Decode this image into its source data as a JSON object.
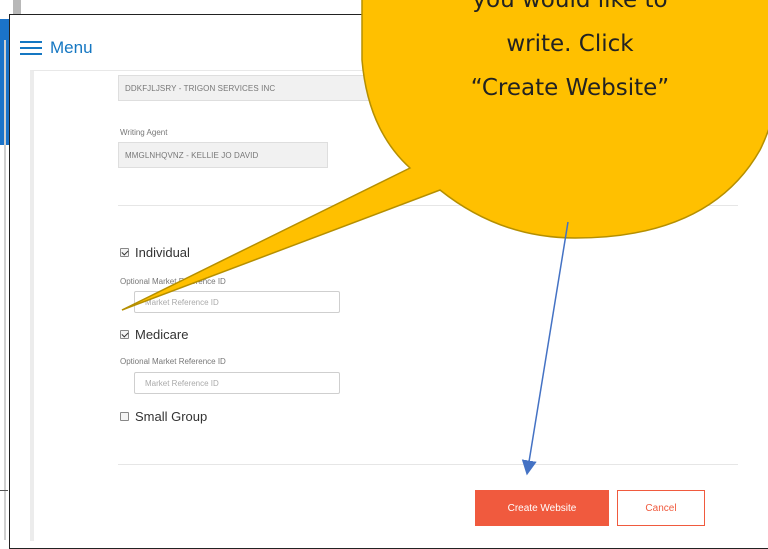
{
  "menu": {
    "label": "Menu",
    "icon": "hamburger-menu-icon"
  },
  "agency": {
    "value": "DDKFJLJSRY - TRIGON SERVICES INC"
  },
  "writing_agent": {
    "label": "Writing Agent",
    "value": "MMGLNHQVNZ - KELLIE JO DAVID"
  },
  "products": [
    {
      "label": "Individual",
      "checked": true,
      "ref_label": "Optional Market Reference ID",
      "ref_placeholder": "Market Reference ID"
    },
    {
      "label": "Medicare",
      "checked": true,
      "ref_label": "Optional Market Reference ID",
      "ref_placeholder": "Market Reference ID"
    },
    {
      "label": "Small Group",
      "checked": false
    }
  ],
  "buttons": {
    "create": "Create Website",
    "cancel": "Cancel"
  },
  "callout": {
    "lines": [
      "you would like to",
      "write. Click",
      "“Create Website”"
    ],
    "fill_color": "#ffc000",
    "arrow_color": "#4472c4"
  },
  "colors": {
    "menu_blue": "#1577c2",
    "create_button": "#f05a3e"
  }
}
